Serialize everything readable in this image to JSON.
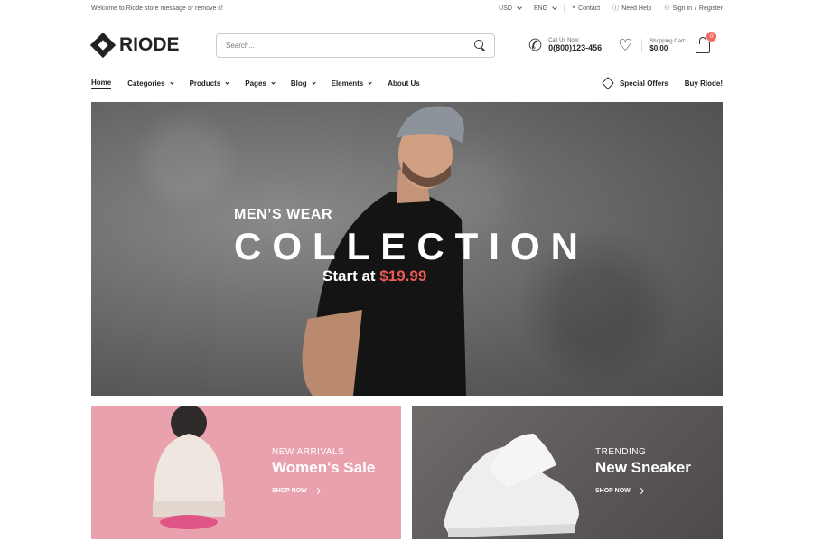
{
  "topbar": {
    "welcome": "Welcome to Riode store message or remove it!",
    "currency": "USD",
    "language": "ENG",
    "contact": "Contact",
    "help": "Need Help",
    "signin": "Sign in",
    "slash": "/",
    "register": "Register"
  },
  "header": {
    "logo": "RIODE",
    "search_placeholder": "Search...",
    "call_label": "Call Us Now:",
    "call_number": "0(800)123-456",
    "cart_label": "Shopping Cart:",
    "cart_total": "$0.00",
    "cart_count": "0"
  },
  "nav": {
    "items": [
      {
        "label": "Home"
      },
      {
        "label": "Categories"
      },
      {
        "label": "Products"
      },
      {
        "label": "Pages"
      },
      {
        "label": "Blog"
      },
      {
        "label": "Elements"
      },
      {
        "label": "About Us"
      }
    ],
    "special_offers": "Special Offers",
    "buy": "Buy Riode!"
  },
  "hero": {
    "subtitle": "MEN’S WEAR",
    "title": "COLLECTION",
    "price_prefix": "Start at ",
    "price": "$19.99"
  },
  "banners": [
    {
      "kicker": "NEW ARRIVALS",
      "title": "Women's Sale",
      "cta": "SHOP NOW"
    },
    {
      "kicker": "TRENDING",
      "title": "New Sneaker",
      "cta": "SHOP NOW"
    }
  ],
  "colors": {
    "accent": "#ee5b55",
    "pink_banner": "#e9a2ad",
    "gray_banner": "#5a5656"
  }
}
